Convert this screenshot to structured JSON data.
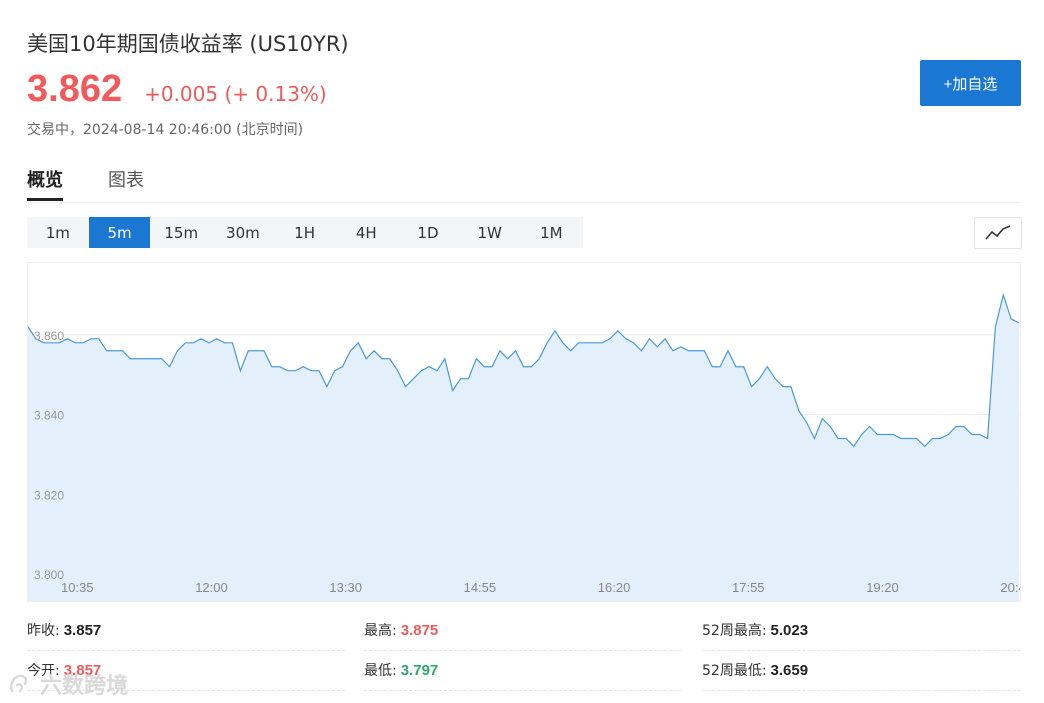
{
  "header": {
    "title": "美国10年期国债收益率 (US10YR)",
    "price": "3.862",
    "change": "+0.005 (+ 0.13%)",
    "status": "交易中，2024-08-14 20:46:00 (北京时间)",
    "add_button": "+加自选"
  },
  "tabs": [
    "概览",
    "图表"
  ],
  "intervals": [
    "1m",
    "5m",
    "15m",
    "30m",
    "1H",
    "4H",
    "1D",
    "1W",
    "1M"
  ],
  "active_interval": "5m",
  "chart_data": {
    "type": "area",
    "x_ticks": [
      "10:35",
      "12:00",
      "13:30",
      "14:55",
      "16:20",
      "17:55",
      "19:20",
      "20:4"
    ],
    "y_ticks": [
      "3.800",
      "3.820",
      "3.840",
      "3.860"
    ],
    "ylim": [
      3.8,
      3.872
    ],
    "grid": true,
    "line_color": "#4a9ad6",
    "fill_color": "#e3f0fc",
    "values": [
      3.862,
      3.859,
      3.858,
      3.858,
      3.858,
      3.859,
      3.858,
      3.858,
      3.859,
      3.859,
      3.856,
      3.856,
      3.856,
      3.854,
      3.854,
      3.854,
      3.854,
      3.854,
      3.852,
      3.856,
      3.858,
      3.858,
      3.859,
      3.858,
      3.859,
      3.858,
      3.858,
      3.851,
      3.856,
      3.856,
      3.856,
      3.852,
      3.852,
      3.851,
      3.851,
      3.852,
      3.851,
      3.851,
      3.847,
      3.851,
      3.852,
      3.856,
      3.858,
      3.854,
      3.856,
      3.854,
      3.854,
      3.851,
      3.847,
      3.849,
      3.851,
      3.852,
      3.851,
      3.854,
      3.846,
      3.849,
      3.849,
      3.854,
      3.852,
      3.852,
      3.856,
      3.854,
      3.856,
      3.852,
      3.852,
      3.854,
      3.858,
      3.861,
      3.858,
      3.856,
      3.858,
      3.858,
      3.858,
      3.858,
      3.859,
      3.861,
      3.859,
      3.858,
      3.856,
      3.859,
      3.857,
      3.859,
      3.856,
      3.857,
      3.856,
      3.856,
      3.856,
      3.852,
      3.852,
      3.856,
      3.852,
      3.852,
      3.847,
      3.849,
      3.852,
      3.849,
      3.847,
      3.847,
      3.841,
      3.838,
      3.834,
      3.839,
      3.837,
      3.834,
      3.834,
      3.832,
      3.835,
      3.837,
      3.835,
      3.835,
      3.835,
      3.834,
      3.834,
      3.834,
      3.832,
      3.834,
      3.834,
      3.835,
      3.837,
      3.837,
      3.835,
      3.835,
      3.834,
      3.862,
      3.87,
      3.864,
      3.863
    ]
  },
  "stats": {
    "prev_close_label": "昨收:",
    "prev_close": "3.857",
    "high_label": "最高:",
    "high": "3.875",
    "high52_label": "52周最高:",
    "high52": "5.023",
    "open_label": "今开:",
    "open": "3.857",
    "low_label": "最低:",
    "low": "3.797",
    "low52_label": "52周最低:",
    "low52": "3.659"
  },
  "watermark": "六数跨境"
}
